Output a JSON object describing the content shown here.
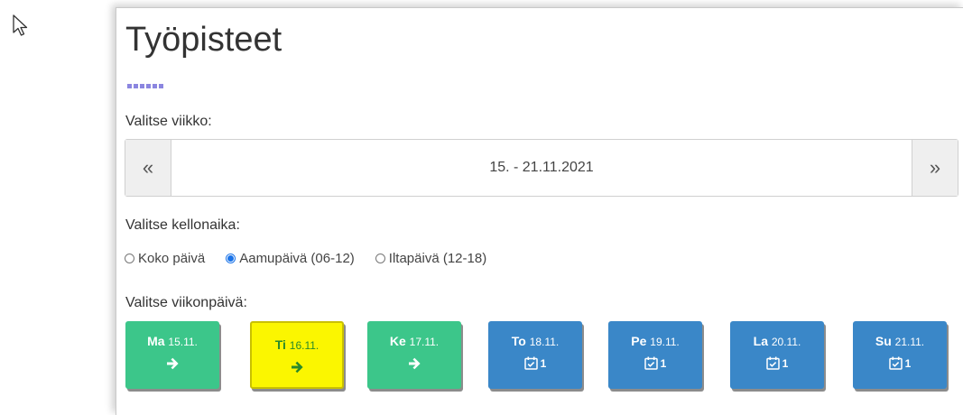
{
  "page_title": "Työpisteet",
  "week_label": "Valitse viikko:",
  "week": {
    "prev": "«",
    "range": "15. - 21.11.2021",
    "next": "»"
  },
  "time_label": "Valitse kellonaika:",
  "time_options": [
    {
      "label": "Koko päivä",
      "checked": false
    },
    {
      "label": "Aamupäivä (06-12)",
      "checked": true
    },
    {
      "label": "Iltapäivä (12-18)",
      "checked": false
    }
  ],
  "weekday_label": "Valitse viikonpäivä:",
  "days": [
    {
      "abbr": "Ma",
      "date": "15.11.",
      "style": "green",
      "icon": "arrow-right-icon"
    },
    {
      "abbr": "Ti",
      "date": "16.11.",
      "style": "yellow",
      "icon": "arrow-right-icon"
    },
    {
      "abbr": "Ke",
      "date": "17.11.",
      "style": "green",
      "icon": "arrow-right-icon"
    },
    {
      "abbr": "To",
      "date": "18.11.",
      "style": "blue",
      "icon": "calendar-check-icon",
      "count": "1"
    },
    {
      "abbr": "Pe",
      "date": "19.11.",
      "style": "blue",
      "icon": "calendar-check-icon",
      "count": "1"
    },
    {
      "abbr": "La",
      "date": "20.11.",
      "style": "blue",
      "icon": "calendar-check-icon",
      "count": "1"
    },
    {
      "abbr": "Su",
      "date": "21.11.",
      "style": "blue",
      "icon": "calendar-check-icon",
      "count": "1"
    }
  ],
  "colors": {
    "green": "#3cc68a",
    "blue": "#3a87c8",
    "yellow": "#fbf600",
    "accent_dots": "#8b86e0",
    "radio_selected": "#1a73e8"
  }
}
